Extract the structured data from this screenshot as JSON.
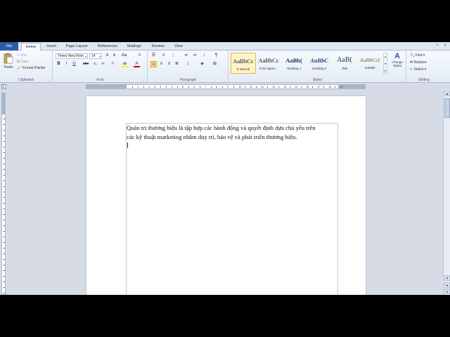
{
  "tabs": [
    {
      "label": "File"
    },
    {
      "label": "Home"
    },
    {
      "label": "Insert"
    },
    {
      "label": "Page Layout"
    },
    {
      "label": "References"
    },
    {
      "label": "Mailings"
    },
    {
      "label": "Review"
    },
    {
      "label": "View"
    }
  ],
  "window_controls": {
    "help": "?",
    "minimize_ribbon": "^"
  },
  "clipboard": {
    "paste": "Paste",
    "cut": "Cut",
    "copy": "Copy",
    "format_painter": "Format Painter",
    "group": "Clipboard"
  },
  "font": {
    "name": "Times New Rom",
    "size": "14",
    "grow": "A",
    "shrink": "A",
    "change_case": "Aa",
    "clear": "A",
    "bold": "B",
    "italic": "I",
    "underline": "U",
    "strike": "abc",
    "subscript": "x₂",
    "superscript": "x²",
    "effects": "A",
    "highlight": "ab",
    "color": "A",
    "group": "Font"
  },
  "paragraph": {
    "group": "Paragraph",
    "show_marks": "¶"
  },
  "styles": {
    "group": "Styles",
    "items": [
      {
        "sample": "AaBbCc",
        "name": "¶ Normal"
      },
      {
        "sample": "AaBbCc",
        "name": "¶ No Spaci..."
      },
      {
        "sample": "AaBb(",
        "name": "Heading 1"
      },
      {
        "sample": "AaBbC",
        "name": "Heading 2"
      },
      {
        "sample": "AaB(",
        "name": "Title"
      },
      {
        "sample": "AaBbCcI",
        "name": "Subtitle"
      }
    ],
    "change_styles": "Change Styles"
  },
  "editing": {
    "group": "Editing",
    "find": "Find",
    "replace": "Replace",
    "select": "Select"
  },
  "document": {
    "line1": "Quản trị thương hiệu là tập hợp các  hành động và quyết định dựa chủ yếu trên",
    "line2": "các kỹ thuật marketing nhằm duy trì, bảo vệ và phát triển thương hiệu."
  },
  "ruler": {
    "numbers": [
      "1",
      "2",
      "3",
      "4",
      "5",
      "6",
      "7",
      "8",
      "9",
      "10",
      "11",
      "12",
      "13",
      "14",
      "15",
      "16",
      "17",
      "18",
      "19"
    ]
  },
  "colors": {
    "file_tab": "#2a5da8",
    "selected_style": "#fff3c9",
    "workspace": "#d6dbe6"
  }
}
